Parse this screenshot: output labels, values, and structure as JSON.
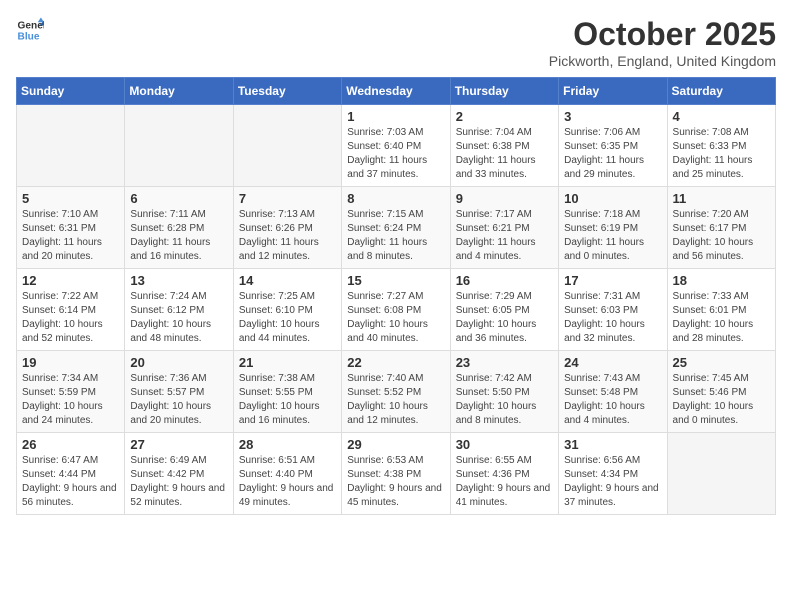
{
  "logo": {
    "line1": "General",
    "line2": "Blue"
  },
  "title": "October 2025",
  "subtitle": "Pickworth, England, United Kingdom",
  "days_of_week": [
    "Sunday",
    "Monday",
    "Tuesday",
    "Wednesday",
    "Thursday",
    "Friday",
    "Saturday"
  ],
  "weeks": [
    [
      {
        "day": "",
        "content": ""
      },
      {
        "day": "",
        "content": ""
      },
      {
        "day": "",
        "content": ""
      },
      {
        "day": "1",
        "content": "Sunrise: 7:03 AM\nSunset: 6:40 PM\nDaylight: 11 hours\nand 37 minutes."
      },
      {
        "day": "2",
        "content": "Sunrise: 7:04 AM\nSunset: 6:38 PM\nDaylight: 11 hours\nand 33 minutes."
      },
      {
        "day": "3",
        "content": "Sunrise: 7:06 AM\nSunset: 6:35 PM\nDaylight: 11 hours\nand 29 minutes."
      },
      {
        "day": "4",
        "content": "Sunrise: 7:08 AM\nSunset: 6:33 PM\nDaylight: 11 hours\nand 25 minutes."
      }
    ],
    [
      {
        "day": "5",
        "content": "Sunrise: 7:10 AM\nSunset: 6:31 PM\nDaylight: 11 hours\nand 20 minutes."
      },
      {
        "day": "6",
        "content": "Sunrise: 7:11 AM\nSunset: 6:28 PM\nDaylight: 11 hours\nand 16 minutes."
      },
      {
        "day": "7",
        "content": "Sunrise: 7:13 AM\nSunset: 6:26 PM\nDaylight: 11 hours\nand 12 minutes."
      },
      {
        "day": "8",
        "content": "Sunrise: 7:15 AM\nSunset: 6:24 PM\nDaylight: 11 hours\nand 8 minutes."
      },
      {
        "day": "9",
        "content": "Sunrise: 7:17 AM\nSunset: 6:21 PM\nDaylight: 11 hours\nand 4 minutes."
      },
      {
        "day": "10",
        "content": "Sunrise: 7:18 AM\nSunset: 6:19 PM\nDaylight: 11 hours\nand 0 minutes."
      },
      {
        "day": "11",
        "content": "Sunrise: 7:20 AM\nSunset: 6:17 PM\nDaylight: 10 hours\nand 56 minutes."
      }
    ],
    [
      {
        "day": "12",
        "content": "Sunrise: 7:22 AM\nSunset: 6:14 PM\nDaylight: 10 hours\nand 52 minutes."
      },
      {
        "day": "13",
        "content": "Sunrise: 7:24 AM\nSunset: 6:12 PM\nDaylight: 10 hours\nand 48 minutes."
      },
      {
        "day": "14",
        "content": "Sunrise: 7:25 AM\nSunset: 6:10 PM\nDaylight: 10 hours\nand 44 minutes."
      },
      {
        "day": "15",
        "content": "Sunrise: 7:27 AM\nSunset: 6:08 PM\nDaylight: 10 hours\nand 40 minutes."
      },
      {
        "day": "16",
        "content": "Sunrise: 7:29 AM\nSunset: 6:05 PM\nDaylight: 10 hours\nand 36 minutes."
      },
      {
        "day": "17",
        "content": "Sunrise: 7:31 AM\nSunset: 6:03 PM\nDaylight: 10 hours\nand 32 minutes."
      },
      {
        "day": "18",
        "content": "Sunrise: 7:33 AM\nSunset: 6:01 PM\nDaylight: 10 hours\nand 28 minutes."
      }
    ],
    [
      {
        "day": "19",
        "content": "Sunrise: 7:34 AM\nSunset: 5:59 PM\nDaylight: 10 hours\nand 24 minutes."
      },
      {
        "day": "20",
        "content": "Sunrise: 7:36 AM\nSunset: 5:57 PM\nDaylight: 10 hours\nand 20 minutes."
      },
      {
        "day": "21",
        "content": "Sunrise: 7:38 AM\nSunset: 5:55 PM\nDaylight: 10 hours\nand 16 minutes."
      },
      {
        "day": "22",
        "content": "Sunrise: 7:40 AM\nSunset: 5:52 PM\nDaylight: 10 hours\nand 12 minutes."
      },
      {
        "day": "23",
        "content": "Sunrise: 7:42 AM\nSunset: 5:50 PM\nDaylight: 10 hours\nand 8 minutes."
      },
      {
        "day": "24",
        "content": "Sunrise: 7:43 AM\nSunset: 5:48 PM\nDaylight: 10 hours\nand 4 minutes."
      },
      {
        "day": "25",
        "content": "Sunrise: 7:45 AM\nSunset: 5:46 PM\nDaylight: 10 hours\nand 0 minutes."
      }
    ],
    [
      {
        "day": "26",
        "content": "Sunrise: 6:47 AM\nSunset: 4:44 PM\nDaylight: 9 hours\nand 56 minutes."
      },
      {
        "day": "27",
        "content": "Sunrise: 6:49 AM\nSunset: 4:42 PM\nDaylight: 9 hours\nand 52 minutes."
      },
      {
        "day": "28",
        "content": "Sunrise: 6:51 AM\nSunset: 4:40 PM\nDaylight: 9 hours\nand 49 minutes."
      },
      {
        "day": "29",
        "content": "Sunrise: 6:53 AM\nSunset: 4:38 PM\nDaylight: 9 hours\nand 45 minutes."
      },
      {
        "day": "30",
        "content": "Sunrise: 6:55 AM\nSunset: 4:36 PM\nDaylight: 9 hours\nand 41 minutes."
      },
      {
        "day": "31",
        "content": "Sunrise: 6:56 AM\nSunset: 4:34 PM\nDaylight: 9 hours\nand 37 minutes."
      },
      {
        "day": "",
        "content": ""
      }
    ]
  ]
}
